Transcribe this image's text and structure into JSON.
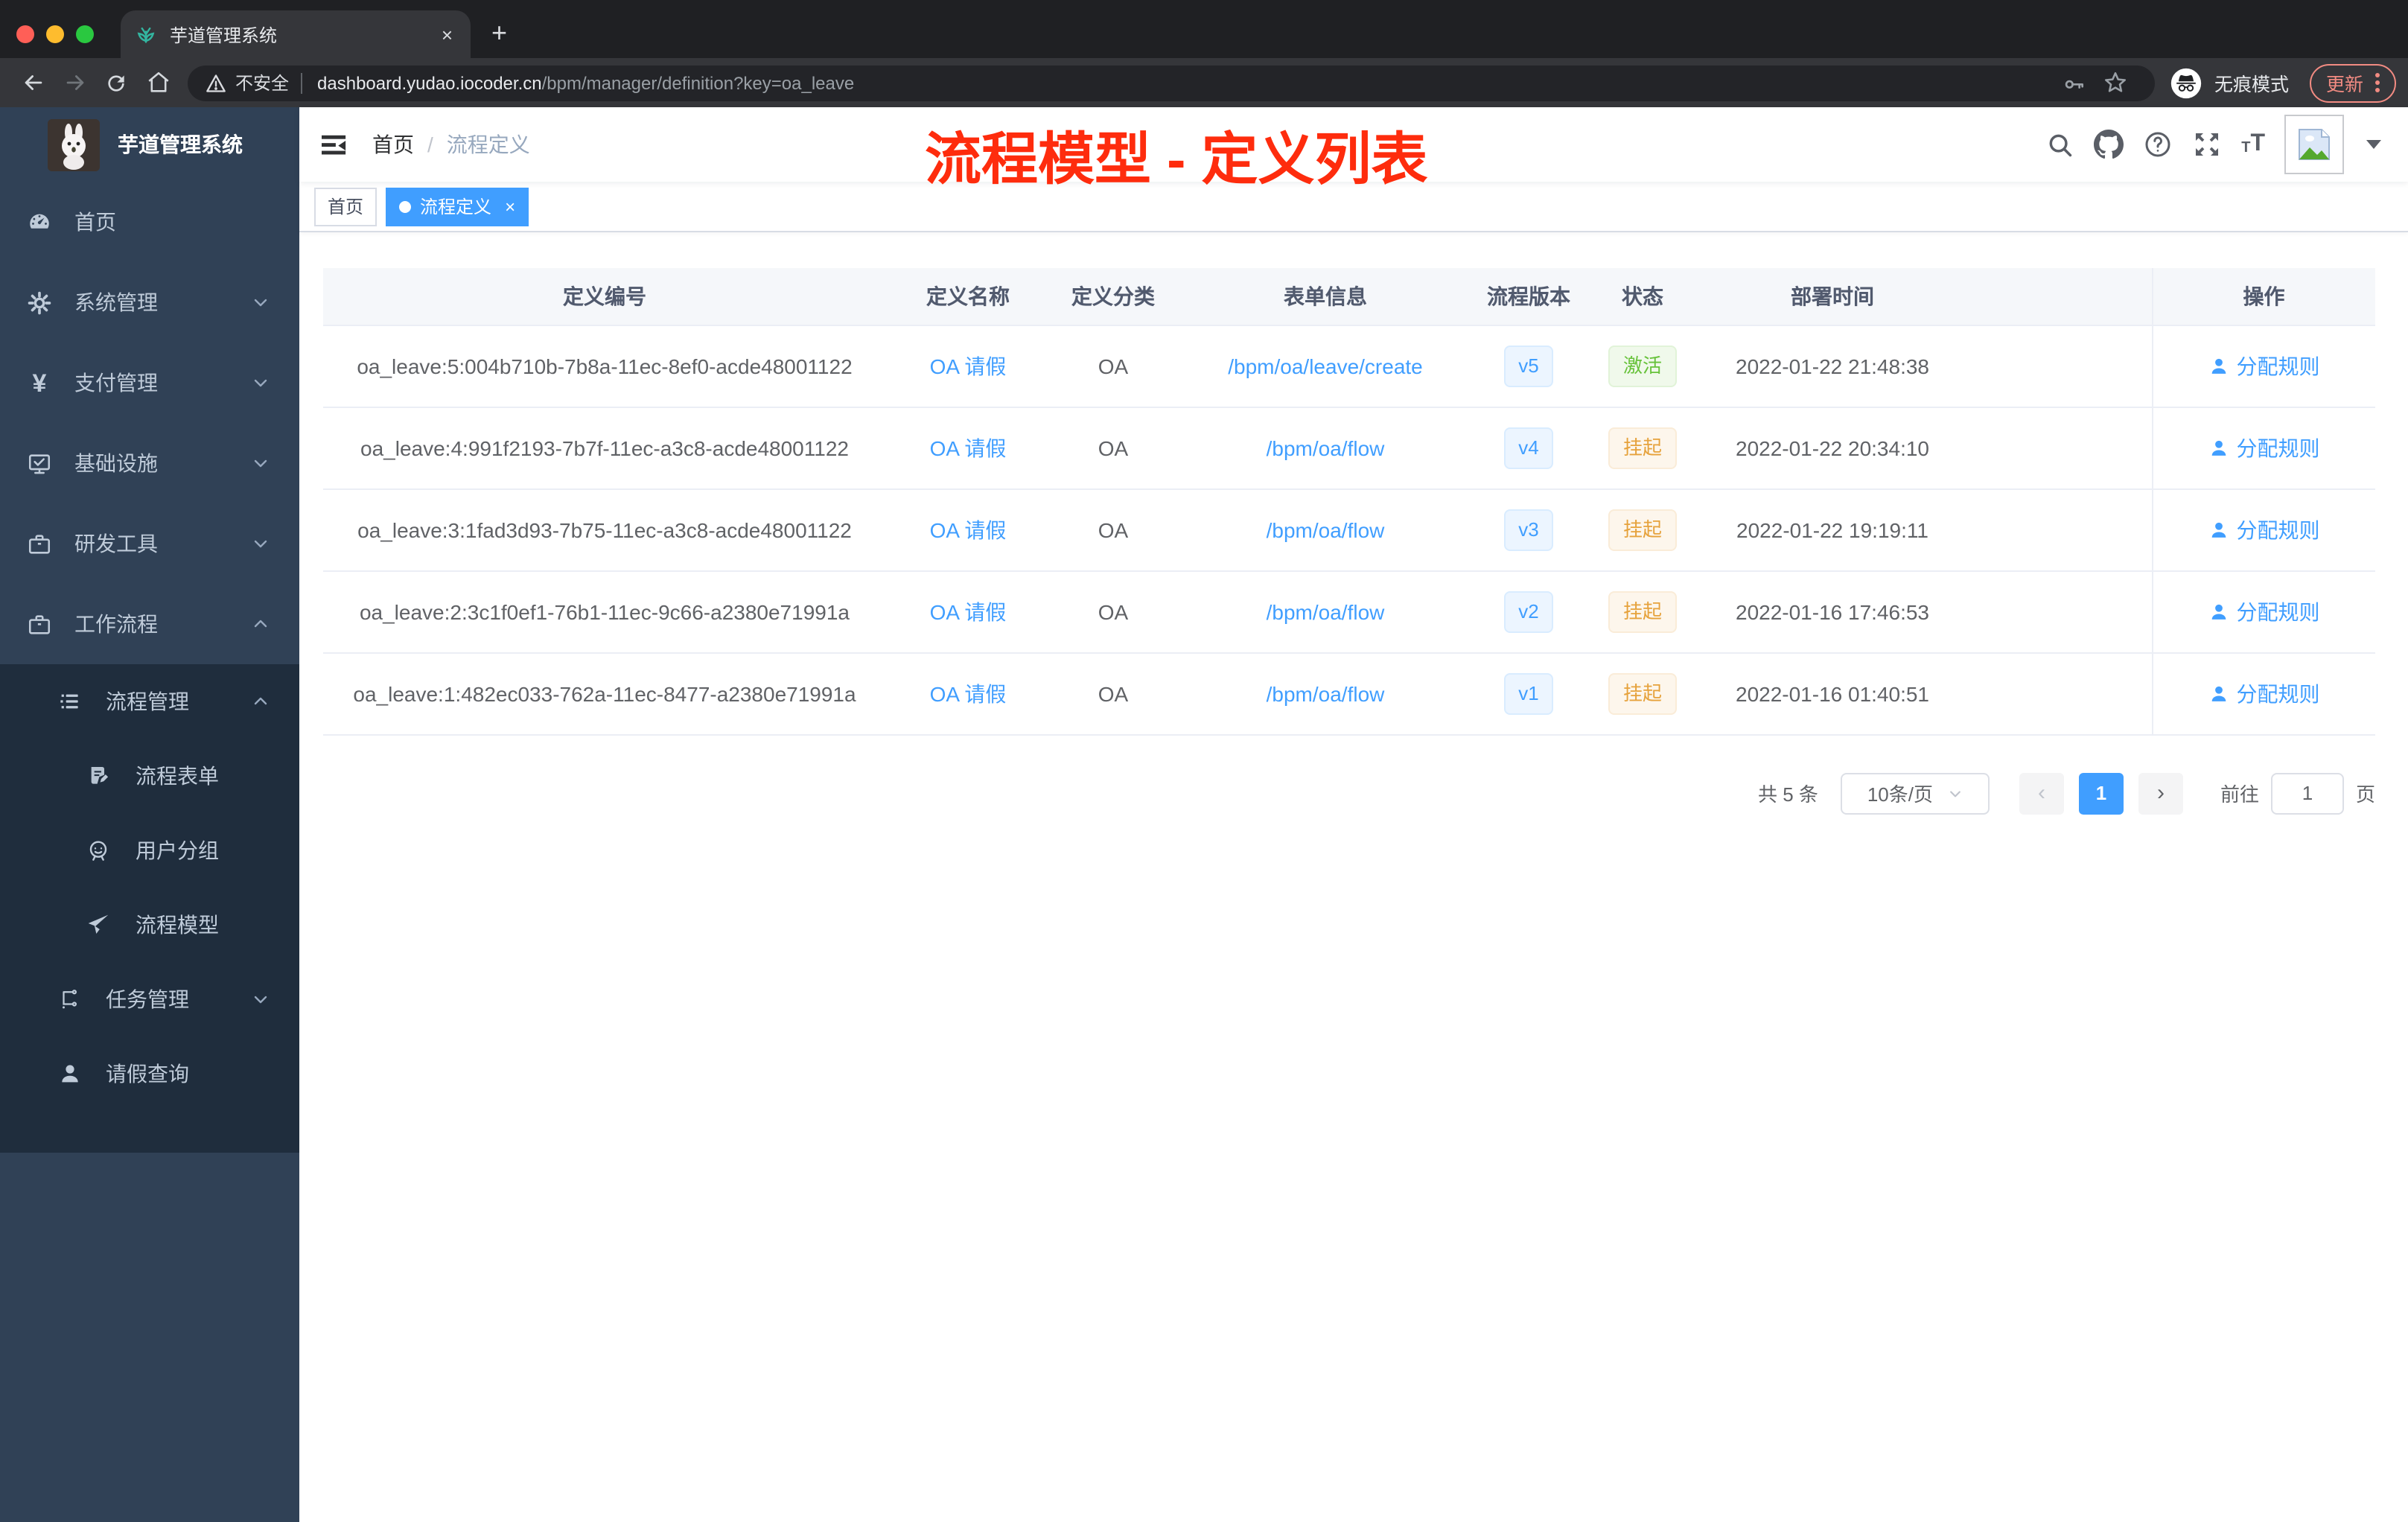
{
  "browser": {
    "tab": {
      "title": "芋道管理系统",
      "close": "×",
      "new_tab": "+"
    },
    "address": {
      "security_label": "不安全",
      "url_host": "dashboard.yudao.iocoder.cn",
      "url_path": "/bpm/manager/definition?key=oa_leave"
    },
    "incognito_label": "无痕模式",
    "update_label": "更新"
  },
  "sidebar": {
    "logo_title": "芋道管理系统",
    "items": [
      {
        "label": "首页"
      },
      {
        "label": "系统管理"
      },
      {
        "label": "支付管理"
      },
      {
        "label": "基础设施"
      },
      {
        "label": "研发工具"
      },
      {
        "label": "工作流程"
      },
      {
        "label": "流程管理"
      },
      {
        "label": "流程表单"
      },
      {
        "label": "用户分组"
      },
      {
        "label": "流程模型"
      },
      {
        "label": "任务管理"
      },
      {
        "label": "请假查询"
      }
    ]
  },
  "header": {
    "breadcrumb": {
      "home": "首页",
      "separator": "/",
      "current": "流程定义"
    }
  },
  "annotation": "流程模型 - 定义列表",
  "tags": {
    "home": "首页",
    "active": "流程定义",
    "close": "×"
  },
  "table": {
    "columns": [
      "定义编号",
      "定义名称",
      "定义分类",
      "表单信息",
      "流程版本",
      "状态",
      "部署时间",
      "操作"
    ],
    "rows": [
      {
        "id": "oa_leave:5:004b710b-7b8a-11ec-8ef0-acde48001122",
        "name": "OA 请假",
        "category": "OA",
        "form": "/bpm/oa/leave/create",
        "version": "v5",
        "status": "激活",
        "status_type": "success",
        "time": "2022-01-22 21:48:38",
        "action": "分配规则"
      },
      {
        "id": "oa_leave:4:991f2193-7b7f-11ec-a3c8-acde48001122",
        "name": "OA 请假",
        "category": "OA",
        "form": "/bpm/oa/flow",
        "version": "v4",
        "status": "挂起",
        "status_type": "warning",
        "time": "2022-01-22 20:34:10",
        "action": "分配规则"
      },
      {
        "id": "oa_leave:3:1fad3d93-7b75-11ec-a3c8-acde48001122",
        "name": "OA 请假",
        "category": "OA",
        "form": "/bpm/oa/flow",
        "version": "v3",
        "status": "挂起",
        "status_type": "warning",
        "time": "2022-01-22 19:19:11",
        "action": "分配规则"
      },
      {
        "id": "oa_leave:2:3c1f0ef1-76b1-11ec-9c66-a2380e71991a",
        "name": "OA 请假",
        "category": "OA",
        "form": "/bpm/oa/flow",
        "version": "v2",
        "status": "挂起",
        "status_type": "warning",
        "time": "2022-01-16 17:46:53",
        "action": "分配规则"
      },
      {
        "id": "oa_leave:1:482ec033-762a-11ec-8477-a2380e71991a",
        "name": "OA 请假",
        "category": "OA",
        "form": "/bpm/oa/flow",
        "version": "v1",
        "status": "挂起",
        "status_type": "warning",
        "time": "2022-01-16 01:40:51",
        "action": "分配规则"
      }
    ]
  },
  "pagination": {
    "total": "共 5 条",
    "page_size": "10条/页",
    "prev": "‹",
    "current": "1",
    "next": "›",
    "goto_label": "前往",
    "goto_value": "1",
    "unit": "页"
  },
  "colors": {
    "accent": "#409EFF",
    "annotation_red": "#FE2C0D",
    "success_green": "#67C23A",
    "warning_orange": "#E6A23C"
  }
}
